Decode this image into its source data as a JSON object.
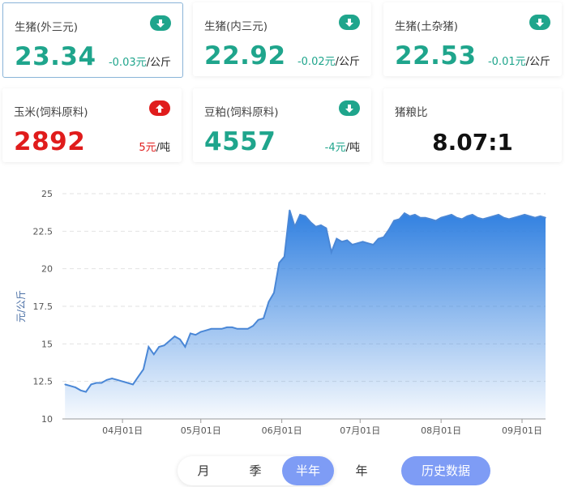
{
  "cards": [
    {
      "title": "生猪(外三元)",
      "value": "23.34",
      "delta": "-0.03元",
      "unit": "/公斤",
      "trend": "down"
    },
    {
      "title": "生猪(内三元)",
      "value": "22.92",
      "delta": "-0.02元",
      "unit": "/公斤",
      "trend": "down"
    },
    {
      "title": "生猪(土杂猪)",
      "value": "22.53",
      "delta": "-0.01元",
      "unit": "/公斤",
      "trend": "down"
    },
    {
      "title": "玉米(饲料原料)",
      "value": "2892",
      "delta": "5元",
      "unit": "/吨",
      "trend": "up"
    },
    {
      "title": "豆粕(饲料原料)",
      "value": "4557",
      "delta": "-4元",
      "unit": "/吨",
      "trend": "down"
    },
    {
      "title": "猪粮比",
      "value": "8.07:1"
    }
  ],
  "colors": {
    "down": "#1fa58c",
    "up": "#e01c1c",
    "accent": "#7e9cf5",
    "line": "#4a87d6"
  },
  "periods": {
    "month": "月",
    "season": "季",
    "half_year": "半年",
    "year": "年",
    "selected": "半年"
  },
  "history_button": "历史数据",
  "chart_data": {
    "type": "area",
    "ylabel": "元/公斤",
    "ylim": [
      10,
      25
    ],
    "yticks": [
      "10",
      "12.5",
      "15",
      "17.5",
      "20",
      "22.5",
      "25"
    ],
    "xlim": [
      "2023-03-09",
      "2023-09-10"
    ],
    "xticks": [
      "04月01日",
      "05月01日",
      "06月01日",
      "07月01日",
      "08月01日",
      "09月01日"
    ],
    "grid": "horizontal dashed",
    "series": [
      {
        "x": [
          "2023-03-10",
          "2023-03-12",
          "2023-03-14",
          "2023-03-16",
          "2023-03-18",
          "2023-03-20",
          "2023-03-22",
          "2023-03-24",
          "2023-03-26",
          "2023-03-28",
          "2023-03-30",
          "2023-04-01",
          "2023-04-03",
          "2023-04-05",
          "2023-04-07",
          "2023-04-09",
          "2023-04-11",
          "2023-04-13",
          "2023-04-15",
          "2023-04-17",
          "2023-04-19",
          "2023-04-21",
          "2023-04-23",
          "2023-04-25",
          "2023-04-27",
          "2023-04-29",
          "2023-05-01",
          "2023-05-03",
          "2023-05-05",
          "2023-05-07",
          "2023-05-09",
          "2023-05-11",
          "2023-05-13",
          "2023-05-15",
          "2023-05-17",
          "2023-05-19",
          "2023-05-21",
          "2023-05-23",
          "2023-05-25",
          "2023-05-27",
          "2023-05-29",
          "2023-05-31",
          "2023-06-02",
          "2023-06-04",
          "2023-06-06",
          "2023-06-08",
          "2023-06-10",
          "2023-06-12",
          "2023-06-14",
          "2023-06-16",
          "2023-06-18",
          "2023-06-20",
          "2023-06-22",
          "2023-06-24",
          "2023-06-26",
          "2023-06-28",
          "2023-06-30",
          "2023-07-02",
          "2023-07-04",
          "2023-07-06",
          "2023-07-08",
          "2023-07-10",
          "2023-07-12",
          "2023-07-14",
          "2023-07-16",
          "2023-07-18",
          "2023-07-20",
          "2023-07-22",
          "2023-07-24",
          "2023-07-26",
          "2023-07-28",
          "2023-07-30",
          "2023-08-01",
          "2023-08-03",
          "2023-08-05",
          "2023-08-07",
          "2023-08-09",
          "2023-08-11",
          "2023-08-13",
          "2023-08-15",
          "2023-08-17",
          "2023-08-19",
          "2023-08-21",
          "2023-08-23",
          "2023-08-25",
          "2023-08-27",
          "2023-08-29",
          "2023-08-31",
          "2023-09-02",
          "2023-09-04",
          "2023-09-06",
          "2023-09-08",
          "2023-09-10"
        ],
        "y": [
          12.3,
          12.2,
          12.1,
          11.9,
          11.8,
          12.3,
          12.4,
          12.4,
          12.6,
          12.7,
          12.6,
          12.5,
          12.4,
          12.3,
          12.8,
          13.3,
          14.8,
          14.3,
          14.8,
          14.9,
          15.2,
          15.5,
          15.3,
          14.8,
          15.7,
          15.6,
          15.8,
          15.9,
          16.0,
          16.0,
          16.0,
          16.1,
          16.1,
          16.0,
          16.0,
          16.0,
          16.2,
          16.6,
          16.7,
          17.8,
          18.4,
          20.4,
          20.8,
          23.9,
          22.8,
          23.6,
          23.5,
          23.1,
          22.8,
          22.9,
          22.7,
          21.1,
          22.0,
          21.8,
          21.9,
          21.6,
          21.7,
          21.8,
          21.7,
          21.6,
          22.0,
          22.1,
          22.6,
          23.2,
          23.3,
          23.7,
          23.5,
          23.6,
          23.4,
          23.4,
          23.3,
          23.2,
          23.4,
          23.5,
          23.6,
          23.4,
          23.3,
          23.5,
          23.6,
          23.4,
          23.3,
          23.4,
          23.5,
          23.6,
          23.4,
          23.3,
          23.4,
          23.5,
          23.6,
          23.5,
          23.4,
          23.5,
          23.4
        ]
      }
    ]
  }
}
